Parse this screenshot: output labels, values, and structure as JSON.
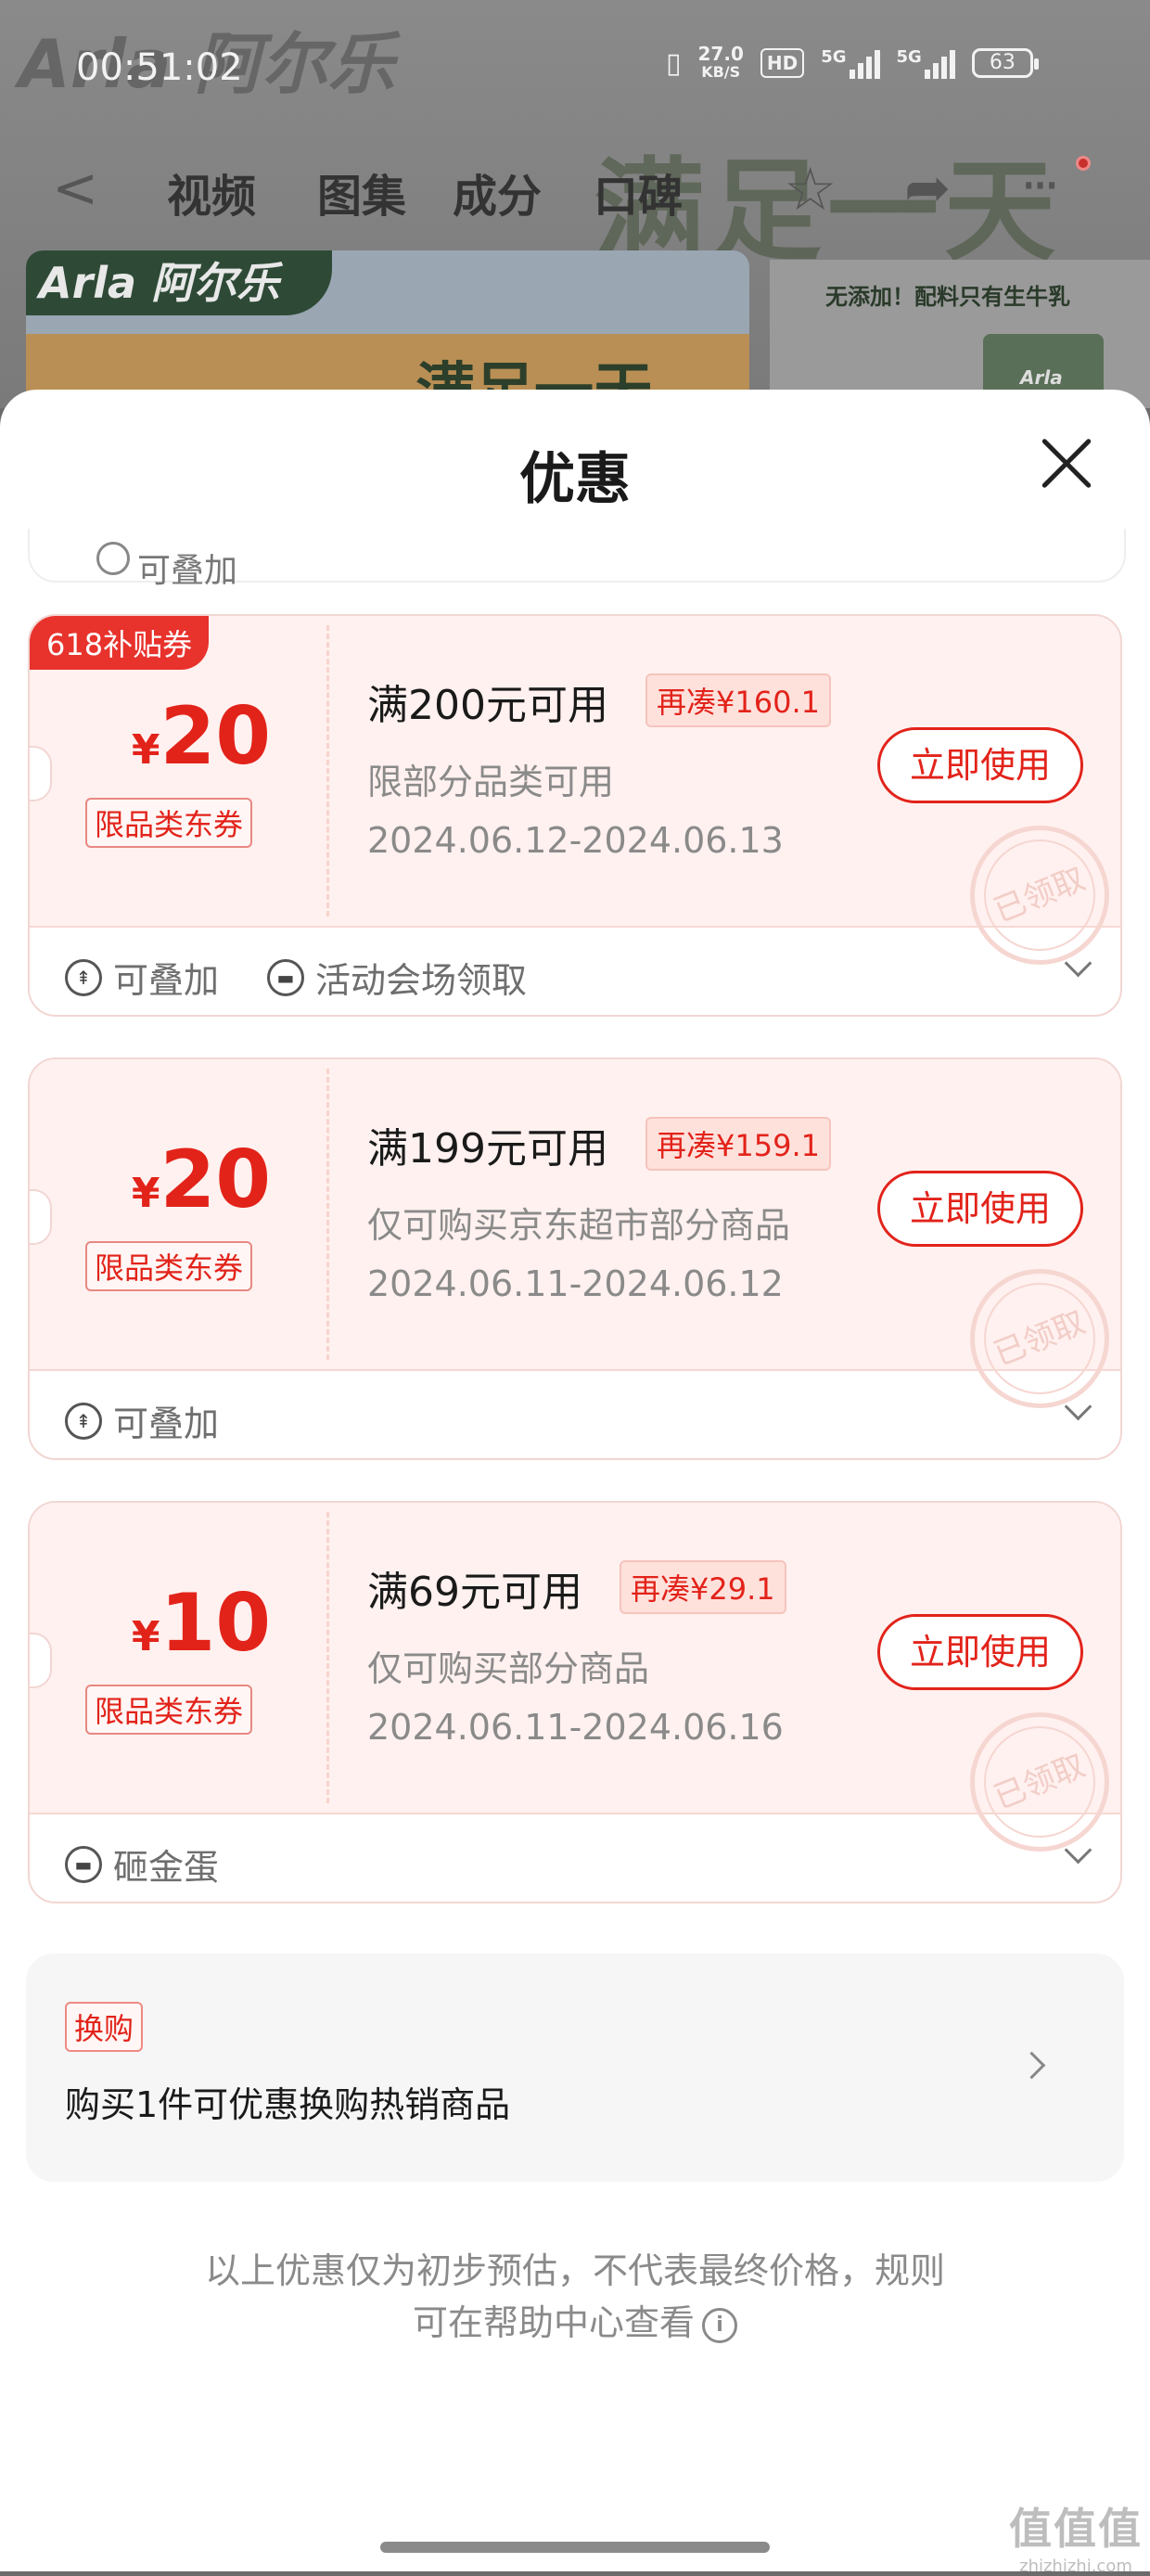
{
  "status_bar": {
    "time": "00:51:02",
    "net_speed_value": "27.0",
    "net_speed_unit": "KB/S",
    "hd_badge": "HD",
    "signal1_label": "5G",
    "signal2_label": "5G",
    "battery": "63"
  },
  "background": {
    "brand": "Arla 阿尔乐",
    "slogan": "满足一天",
    "banner_logo": "Arla 阿尔乐",
    "banner_text": "满足一天",
    "right_text": "无添加！配料只有生牛乳",
    "milk_label": "Arla"
  },
  "nav": {
    "tabs": [
      "视频",
      "图集",
      "成分",
      "口碑"
    ]
  },
  "sheet": {
    "title": "优惠"
  },
  "partial_card": {
    "text": "可叠加"
  },
  "coupons": [
    {
      "badge": "618补贴券",
      "currency": "¥",
      "amount": "20",
      "type": "限品类东券",
      "condition": "满200元可用",
      "topup": "再凑¥160.1",
      "scope": "限部分品类可用",
      "date": "2024.06.12-2024.06.13",
      "button": "立即使用",
      "stamp": "已领取",
      "tags": [
        "可叠加",
        "活动会场领取"
      ]
    },
    {
      "badge": "",
      "currency": "¥",
      "amount": "20",
      "type": "限品类东券",
      "condition": "满199元可用",
      "topup": "再凑¥159.1",
      "scope": "仅可购买京东超市部分商品",
      "date": "2024.06.11-2024.06.12",
      "button": "立即使用",
      "stamp": "已领取",
      "tags": [
        "可叠加"
      ]
    },
    {
      "badge": "",
      "currency": "¥",
      "amount": "10",
      "type": "限品类东券",
      "condition": "满69元可用",
      "topup": "再凑¥29.1",
      "scope": "仅可购买部分商品",
      "date": "2024.06.11-2024.06.16",
      "button": "立即使用",
      "stamp": "已领取",
      "tags": [
        "砸金蛋"
      ]
    }
  ],
  "swap": {
    "tag": "换购",
    "text": "购买1件可优惠换购热销商品"
  },
  "disclaimer": {
    "line1": "以上优惠仅为初步预估，不代表最终价格，规则",
    "line2": "可在帮助中心查看"
  },
  "watermark": {
    "main": "值值值",
    "site": "zhizhizhi.com"
  },
  "colors": {
    "accent": "#e2231a",
    "coupon_bg": "#fff1ef",
    "badge_bg": "#e8322c"
  }
}
